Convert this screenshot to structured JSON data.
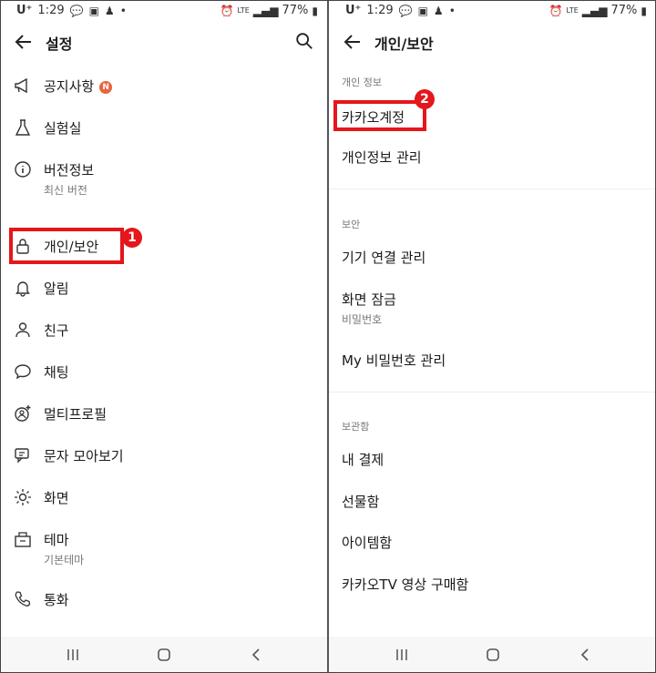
{
  "status_bar": {
    "carrier": "U⁺",
    "time": "1:29",
    "battery": "77%",
    "network": "LTE"
  },
  "left": {
    "title": "설정",
    "items": [
      {
        "label": "공지사항",
        "badge": "N",
        "icon": "megaphone-icon"
      },
      {
        "label": "실험실",
        "icon": "flask-icon"
      },
      {
        "label": "버전정보",
        "sub": "최신 버전",
        "icon": "info-icon"
      },
      {
        "label": "개인/보안",
        "icon": "lock-icon"
      },
      {
        "label": "알림",
        "icon": "bell-icon"
      },
      {
        "label": "친구",
        "icon": "person-icon"
      },
      {
        "label": "채팅",
        "icon": "chat-bubble-icon"
      },
      {
        "label": "멀티프로필",
        "icon": "multi-profile-icon"
      },
      {
        "label": "문자 모아보기",
        "icon": "messages-icon"
      },
      {
        "label": "화면",
        "icon": "brightness-icon"
      },
      {
        "label": "테마",
        "sub": "기본테마",
        "icon": "theme-icon"
      },
      {
        "label": "통화",
        "icon": "phone-icon"
      }
    ],
    "callout": "1"
  },
  "right": {
    "title": "개인/보안",
    "sections": [
      {
        "header": "개인 정보",
        "items": [
          {
            "label": "카카오계정"
          },
          {
            "label": "개인정보 관리"
          }
        ]
      },
      {
        "header": "보안",
        "items": [
          {
            "label": "기기 연결 관리"
          },
          {
            "label": "화면 잠금",
            "sub": "비밀번호"
          },
          {
            "label": "My 비밀번호 관리"
          }
        ]
      },
      {
        "header": "보관함",
        "items": [
          {
            "label": "내 결제"
          },
          {
            "label": "선물함"
          },
          {
            "label": "아이템함"
          },
          {
            "label": "카카오TV 영상 구매함"
          }
        ]
      }
    ],
    "callout": "2"
  },
  "colors": {
    "highlight": "#e5161c",
    "badge": "#e8643c"
  }
}
